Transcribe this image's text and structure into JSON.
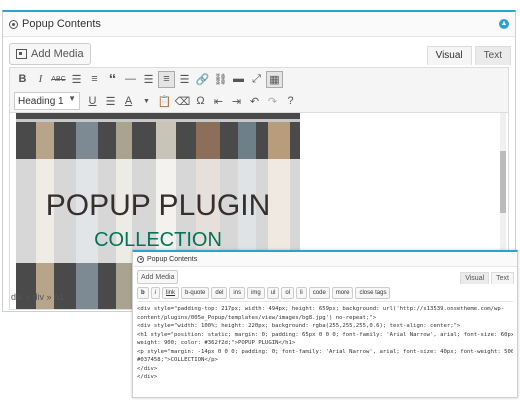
{
  "panel": {
    "title": "Popup Contents",
    "add_media_label": "Add Media",
    "tabs": [
      "Visual",
      "Text"
    ],
    "format_select": "Heading 1",
    "status_path": "div » div » h1"
  },
  "hero": {
    "title": "POPUP PLUGIN",
    "subtitle": "COLLECTION"
  },
  "overlay": {
    "title": "Popup Contents",
    "add_media_label": "Add Media",
    "tabs": [
      "Visual",
      "Text"
    ],
    "quicktags": [
      "b",
      "i",
      "link",
      "b-quote",
      "del",
      "ins",
      "img",
      "ul",
      "ol",
      "li",
      "code",
      "more",
      "close tags"
    ],
    "code_lines": [
      "<div style=\"padding-top: 217px; width: 494px; height: 659px; background: url('http://s13539.onsetheme.com/wp-",
      "content/plugins/005e_Popup/templates/view/images/bg8.jpg') no-repeat;\">",
      "<div style=\"width: 100%; height: 220px; background: rgba(255,255,255,0.6); text-align: center;\">",
      "<h1 style=\"position: static; margin: 0; padding: 65px 0 0 0; font-family: 'Arial Narrow', arial; font-size: 60px; font-",
      "weight: 900; color: #362f2d;\">POPUP PLUGIN</h1>",
      "<p style=\"margin: -14px 0 0 0; padding: 0; font-family: 'Arial Narrow', arial; font-size: 40px; font-weight: 500; color:",
      "#037458;\">COLLECTION</p>",
      "",
      "</div>",
      "</div>"
    ]
  },
  "colors": {
    "accent": "#2ea2cc",
    "title_color": "#362f2d",
    "subtitle_color": "#037458"
  }
}
